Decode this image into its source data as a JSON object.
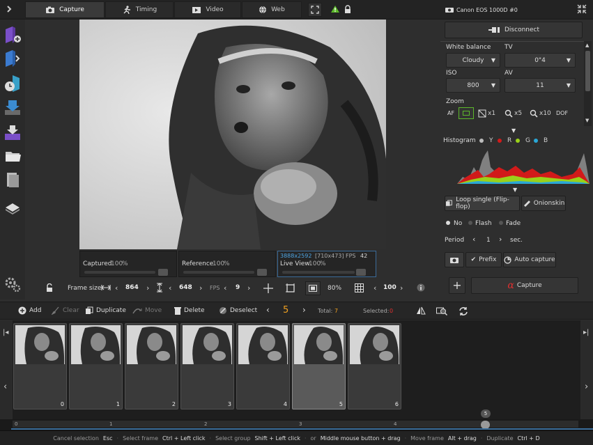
{
  "tabs": [
    {
      "label": "Capture",
      "icon": "camera-icon"
    },
    {
      "label": "Timing",
      "icon": "runner-icon"
    },
    {
      "label": "Video",
      "icon": "film-icon"
    },
    {
      "label": "Web",
      "icon": "globe-icon"
    }
  ],
  "camera": {
    "name": "Canon EOS 1000D #0"
  },
  "connection": {
    "disconnect_label": "Disconnect"
  },
  "settings": {
    "white_balance_label": "White balance",
    "white_balance_value": "Cloudy",
    "tv_label": "TV",
    "tv_value": "0\"4",
    "iso_label": "ISO",
    "iso_value": "800",
    "av_label": "AV",
    "av_value": "11"
  },
  "zoom": {
    "label": "Zoom",
    "af": "AF",
    "x1": "x1",
    "x5": "x5",
    "x10": "x10",
    "dof": "DOF"
  },
  "histogram": {
    "label": "Histogram",
    "channels": [
      "Y",
      "R",
      "G",
      "B"
    ],
    "channel_colors": [
      "#bbbbbb",
      "#d11a1a",
      "#9ad11a",
      "#2aa7d6"
    ]
  },
  "loop": {
    "tab_loop": "Loop single (Flip-flop)",
    "tab_onion": "Onionskin",
    "options": [
      "No",
      "Flash",
      "Fade"
    ],
    "period_label": "Period",
    "period_value": "1",
    "period_unit": "sec."
  },
  "capture": {
    "prefix_label": "Prefix",
    "auto_capture_label": "Auto capture",
    "capture_label": "Capture"
  },
  "sliders": {
    "captured_label": "Captured",
    "captured_value": "100",
    "reference_label": "Reference",
    "reference_value": "100",
    "live_resolution": "3888x2592",
    "live_frame": "[710x473]",
    "live_fps_label": "FPS",
    "live_fps_value": "42",
    "live_label": "Live View",
    "live_value": "100",
    "percent": "%"
  },
  "framebar": {
    "frame_size_label": "Frame size",
    "width": "864",
    "height": "648",
    "fps_label": "FPS",
    "fps_value": "9",
    "zoom_value": "80%",
    "grid_value": "100"
  },
  "editbar": {
    "add": "Add",
    "clear": "Clear",
    "duplicate": "Duplicate",
    "move": "Move",
    "delete": "Delete",
    "deselect": "Deselect",
    "current_frame": "5",
    "total_label": "Total:",
    "total_value": "7",
    "selected_label": "Selected:",
    "selected_value": "0"
  },
  "frames": [
    "0",
    "1",
    "2",
    "3",
    "4",
    "5",
    "6"
  ],
  "selected_frame_index": 5,
  "timeline": {
    "ticks": [
      "0",
      "1",
      "2",
      "3",
      "4"
    ],
    "marker": "5"
  },
  "status": {
    "items": [
      {
        "label": "Cancel selection",
        "key": "Esc"
      },
      {
        "label": "Select frame",
        "key": "Ctrl + Left click"
      },
      {
        "label": "Select group",
        "key": "Shift + Left click"
      },
      {
        "label": "or",
        "key": "Middle mouse button + drag"
      },
      {
        "label": "Move frame",
        "key": "Alt + drag"
      },
      {
        "label": "Duplicate",
        "key": "Ctrl + D"
      }
    ]
  },
  "colors": {
    "accent": "#f0a020",
    "warning": "#e03030",
    "highlight": "#4da3e0"
  }
}
